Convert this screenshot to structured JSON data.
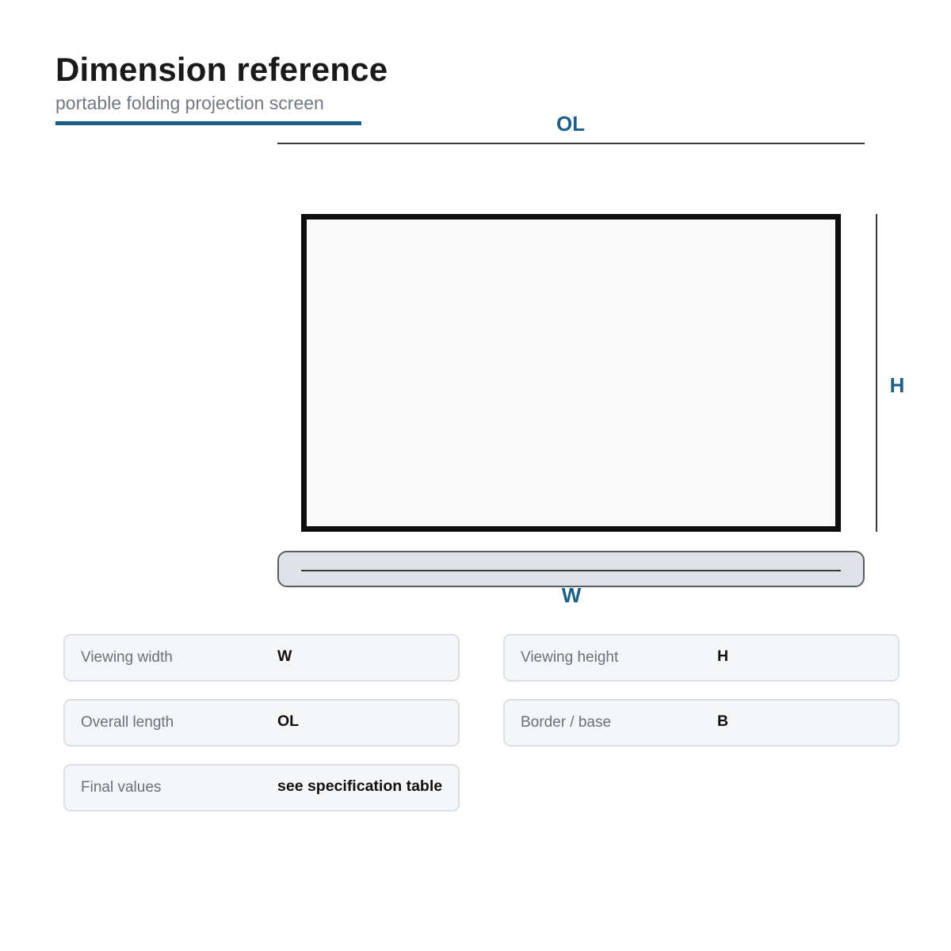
{
  "header": {
    "title": "Dimension reference",
    "subtitle": "portable folding projection screen"
  },
  "diagram": {
    "label_ol": "OL",
    "label_h": "H",
    "label_w": "W"
  },
  "specs": [
    {
      "label": "Viewing width",
      "value": "W"
    },
    {
      "label": "Viewing height",
      "value": "H"
    },
    {
      "label": "Overall length",
      "value": "OL"
    },
    {
      "label": "Border / base",
      "value": "B"
    },
    {
      "label": "Final values",
      "value": "see specification table"
    }
  ],
  "colors": {
    "accent": "#1b5f86",
    "frame": "#0e0e0e",
    "screen_surface": "#f9f9f9",
    "base_fill": "#dfe2e6",
    "card_fill": "#f5f6f8"
  }
}
